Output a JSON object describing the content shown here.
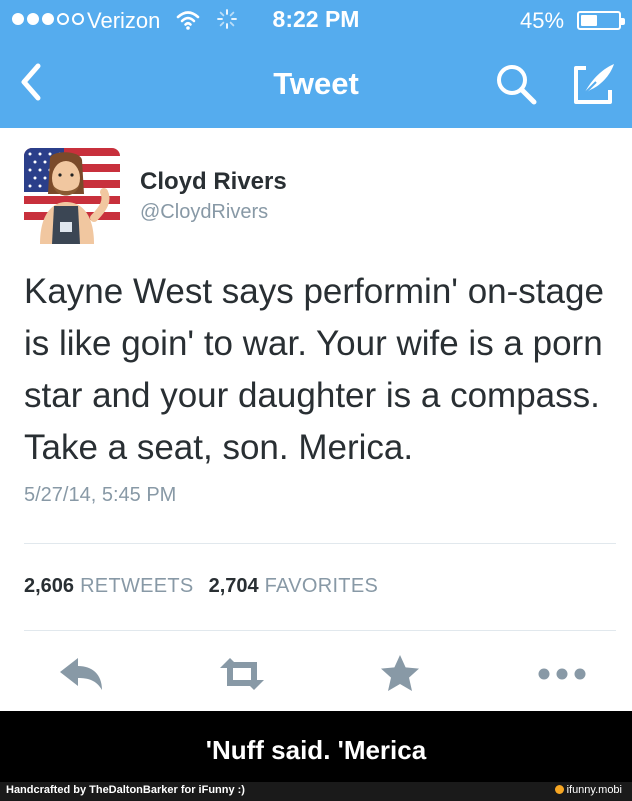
{
  "status_bar": {
    "carrier": "Verizon",
    "time": "8:22 PM",
    "battery_percent": "45%",
    "battery_level": 0.45,
    "signal_bars": 3,
    "signal_max": 5
  },
  "nav": {
    "title": "Tweet",
    "back_icon": "chevron-left-icon",
    "search_icon": "search-icon",
    "compose_icon": "compose-icon"
  },
  "tweet": {
    "author_name": "Cloyd Rivers",
    "author_handle": "@CloydRivers",
    "text": "Kayne West says performin' on-stage is like goin' to war. Your wife is a porn star and your daughter is a compass. Take a seat, son. Merica.",
    "timestamp": "5/27/14, 5:45 PM",
    "retweets_count": "2,606",
    "retweets_label": "RETWEETS",
    "favorites_count": "2,704",
    "favorites_label": "FAVORITES"
  },
  "actions": [
    "reply-icon",
    "retweet-icon",
    "star-icon",
    "more-icon"
  ],
  "caption": "'Nuff said. 'Merica",
  "footer": {
    "credit": "Handcrafted by TheDaltonBarker for iFunny :)",
    "brand": "ifunny.mobi"
  },
  "colors": {
    "accent": "#55acee",
    "text": "#292f33",
    "muted": "#8899a6",
    "icon": "#8899a6"
  }
}
